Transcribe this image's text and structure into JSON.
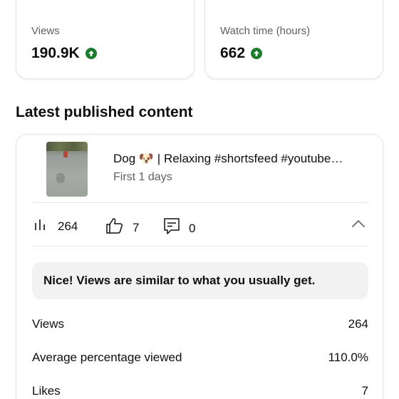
{
  "stats": {
    "views": {
      "label": "Views",
      "value": "190.9K",
      "trend": "up"
    },
    "watch_time": {
      "label": "Watch time (hours)",
      "value": "662",
      "trend": "up"
    }
  },
  "section": {
    "title": "Latest published content"
  },
  "latest": {
    "title": "Dog 🐶 | Relaxing #shortsfeed #youtube…",
    "subtitle": "First 1 days",
    "metrics": {
      "views": "264",
      "likes": "7",
      "comments": "0"
    },
    "banner": "Nice! Views are similar to what you usually get.",
    "rows": [
      {
        "label": "Views",
        "value": "264"
      },
      {
        "label": "Average percentage viewed",
        "value": "110.0%"
      },
      {
        "label": "Likes",
        "value": "7"
      }
    ]
  },
  "colors": {
    "trend_up": "#1b7d2c",
    "muted_text": "#606060",
    "banner_bg": "#f2f2f2"
  }
}
